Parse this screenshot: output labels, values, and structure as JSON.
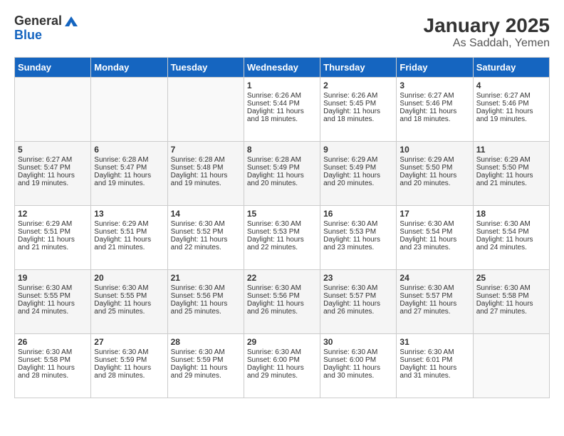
{
  "header": {
    "logo_general": "General",
    "logo_blue": "Blue",
    "month_year": "January 2025",
    "location": "As Saddah, Yemen"
  },
  "days_of_week": [
    "Sunday",
    "Monday",
    "Tuesday",
    "Wednesday",
    "Thursday",
    "Friday",
    "Saturday"
  ],
  "weeks": [
    [
      {
        "day": "",
        "sunrise": "",
        "sunset": "",
        "daylight": ""
      },
      {
        "day": "",
        "sunrise": "",
        "sunset": "",
        "daylight": ""
      },
      {
        "day": "",
        "sunrise": "",
        "sunset": "",
        "daylight": ""
      },
      {
        "day": "1",
        "sunrise": "Sunrise: 6:26 AM",
        "sunset": "Sunset: 5:44 PM",
        "daylight": "Daylight: 11 hours and 18 minutes."
      },
      {
        "day": "2",
        "sunrise": "Sunrise: 6:26 AM",
        "sunset": "Sunset: 5:45 PM",
        "daylight": "Daylight: 11 hours and 18 minutes."
      },
      {
        "day": "3",
        "sunrise": "Sunrise: 6:27 AM",
        "sunset": "Sunset: 5:46 PM",
        "daylight": "Daylight: 11 hours and 18 minutes."
      },
      {
        "day": "4",
        "sunrise": "Sunrise: 6:27 AM",
        "sunset": "Sunset: 5:46 PM",
        "daylight": "Daylight: 11 hours and 19 minutes."
      }
    ],
    [
      {
        "day": "5",
        "sunrise": "Sunrise: 6:27 AM",
        "sunset": "Sunset: 5:47 PM",
        "daylight": "Daylight: 11 hours and 19 minutes."
      },
      {
        "day": "6",
        "sunrise": "Sunrise: 6:28 AM",
        "sunset": "Sunset: 5:47 PM",
        "daylight": "Daylight: 11 hours and 19 minutes."
      },
      {
        "day": "7",
        "sunrise": "Sunrise: 6:28 AM",
        "sunset": "Sunset: 5:48 PM",
        "daylight": "Daylight: 11 hours and 19 minutes."
      },
      {
        "day": "8",
        "sunrise": "Sunrise: 6:28 AM",
        "sunset": "Sunset: 5:49 PM",
        "daylight": "Daylight: 11 hours and 20 minutes."
      },
      {
        "day": "9",
        "sunrise": "Sunrise: 6:29 AM",
        "sunset": "Sunset: 5:49 PM",
        "daylight": "Daylight: 11 hours and 20 minutes."
      },
      {
        "day": "10",
        "sunrise": "Sunrise: 6:29 AM",
        "sunset": "Sunset: 5:50 PM",
        "daylight": "Daylight: 11 hours and 20 minutes."
      },
      {
        "day": "11",
        "sunrise": "Sunrise: 6:29 AM",
        "sunset": "Sunset: 5:50 PM",
        "daylight": "Daylight: 11 hours and 21 minutes."
      }
    ],
    [
      {
        "day": "12",
        "sunrise": "Sunrise: 6:29 AM",
        "sunset": "Sunset: 5:51 PM",
        "daylight": "Daylight: 11 hours and 21 minutes."
      },
      {
        "day": "13",
        "sunrise": "Sunrise: 6:29 AM",
        "sunset": "Sunset: 5:51 PM",
        "daylight": "Daylight: 11 hours and 21 minutes."
      },
      {
        "day": "14",
        "sunrise": "Sunrise: 6:30 AM",
        "sunset": "Sunset: 5:52 PM",
        "daylight": "Daylight: 11 hours and 22 minutes."
      },
      {
        "day": "15",
        "sunrise": "Sunrise: 6:30 AM",
        "sunset": "Sunset: 5:53 PM",
        "daylight": "Daylight: 11 hours and 22 minutes."
      },
      {
        "day": "16",
        "sunrise": "Sunrise: 6:30 AM",
        "sunset": "Sunset: 5:53 PM",
        "daylight": "Daylight: 11 hours and 23 minutes."
      },
      {
        "day": "17",
        "sunrise": "Sunrise: 6:30 AM",
        "sunset": "Sunset: 5:54 PM",
        "daylight": "Daylight: 11 hours and 23 minutes."
      },
      {
        "day": "18",
        "sunrise": "Sunrise: 6:30 AM",
        "sunset": "Sunset: 5:54 PM",
        "daylight": "Daylight: 11 hours and 24 minutes."
      }
    ],
    [
      {
        "day": "19",
        "sunrise": "Sunrise: 6:30 AM",
        "sunset": "Sunset: 5:55 PM",
        "daylight": "Daylight: 11 hours and 24 minutes."
      },
      {
        "day": "20",
        "sunrise": "Sunrise: 6:30 AM",
        "sunset": "Sunset: 5:55 PM",
        "daylight": "Daylight: 11 hours and 25 minutes."
      },
      {
        "day": "21",
        "sunrise": "Sunrise: 6:30 AM",
        "sunset": "Sunset: 5:56 PM",
        "daylight": "Daylight: 11 hours and 25 minutes."
      },
      {
        "day": "22",
        "sunrise": "Sunrise: 6:30 AM",
        "sunset": "Sunset: 5:56 PM",
        "daylight": "Daylight: 11 hours and 26 minutes."
      },
      {
        "day": "23",
        "sunrise": "Sunrise: 6:30 AM",
        "sunset": "Sunset: 5:57 PM",
        "daylight": "Daylight: 11 hours and 26 minutes."
      },
      {
        "day": "24",
        "sunrise": "Sunrise: 6:30 AM",
        "sunset": "Sunset: 5:57 PM",
        "daylight": "Daylight: 11 hours and 27 minutes."
      },
      {
        "day": "25",
        "sunrise": "Sunrise: 6:30 AM",
        "sunset": "Sunset: 5:58 PM",
        "daylight": "Daylight: 11 hours and 27 minutes."
      }
    ],
    [
      {
        "day": "26",
        "sunrise": "Sunrise: 6:30 AM",
        "sunset": "Sunset: 5:58 PM",
        "daylight": "Daylight: 11 hours and 28 minutes."
      },
      {
        "day": "27",
        "sunrise": "Sunrise: 6:30 AM",
        "sunset": "Sunset: 5:59 PM",
        "daylight": "Daylight: 11 hours and 28 minutes."
      },
      {
        "day": "28",
        "sunrise": "Sunrise: 6:30 AM",
        "sunset": "Sunset: 5:59 PM",
        "daylight": "Daylight: 11 hours and 29 minutes."
      },
      {
        "day": "29",
        "sunrise": "Sunrise: 6:30 AM",
        "sunset": "Sunset: 6:00 PM",
        "daylight": "Daylight: 11 hours and 29 minutes."
      },
      {
        "day": "30",
        "sunrise": "Sunrise: 6:30 AM",
        "sunset": "Sunset: 6:00 PM",
        "daylight": "Daylight: 11 hours and 30 minutes."
      },
      {
        "day": "31",
        "sunrise": "Sunrise: 6:30 AM",
        "sunset": "Sunset: 6:01 PM",
        "daylight": "Daylight: 11 hours and 31 minutes."
      },
      {
        "day": "",
        "sunrise": "",
        "sunset": "",
        "daylight": ""
      }
    ]
  ]
}
